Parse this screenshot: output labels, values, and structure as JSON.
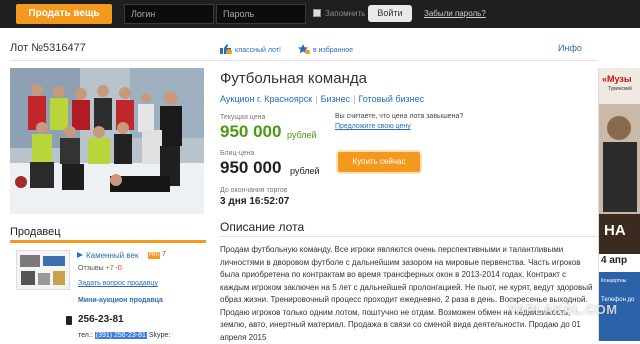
{
  "topbar": {
    "sell_button": "Продать вещь",
    "login_placeholder": "Логин",
    "password_placeholder": "Пароль",
    "remember_label": "Запомнить",
    "login_button": "Войти",
    "forgot_link": "Забыли пароль?"
  },
  "lot": {
    "number": "Лот №5316477",
    "classy_link": "классный лот!",
    "classy_count": "26",
    "favorite_link": "в избранное",
    "favorite_count": "19",
    "info_link": "Инфо",
    "title": "Футбольная команда",
    "breadcrumbs": [
      "Аукцион г. Красноярск",
      "Бизнес",
      "Готовый бизнес"
    ],
    "current_price_label": "Текущая цена",
    "current_price": "950 000",
    "currency": "рублей",
    "blitz_label": "Блиц-цена",
    "blitz_price": "950 000",
    "price_question": "Вы считаете, что цена лота завышена?",
    "suggest_price_link": "Предложите свою цену",
    "buy_now_button": "Купить сейчас",
    "time_left_label": "До окончания торгов",
    "time_left": "3 дня 16:52:07"
  },
  "seller": {
    "heading": "Продавец",
    "name": "Каменный век",
    "pro_badge": "PRO",
    "pro_number": "7",
    "reviews_label": "Отзывы",
    "reviews_positive": "+7",
    "reviews_negative": "-0",
    "ask_question_link": "Задать вопрос продавцу",
    "mini_auction_link": "Мини-аукцион продавца",
    "phone": "256-23-81",
    "tel_label": "тел.:",
    "tel_value": "(391) 256-23-81",
    "skype_label": "Skype:"
  },
  "description": {
    "heading": "Описание лота",
    "text": "Продам футбольную команду. Все игроки являются очень перспективными и талантливыми личностями в дворовом футболе с дальнейшим зазором на мировые первенства. Часть игроков была приобретена по контрактам во время трансферных окон в 2013-2014 годах. Контракт с каждым игроком заключен на 5 лет с дальнейшей пролонгацией. Не пьют, не курят, ведут здоровый образ жизни. Тренировочный процесс проходит ежедневно, 2 раза в день. Воскресенье выходной. Продаю игроков только одним лотом, поштучно не отдам. Возможен обмен на недвижимость, землю, авто, инертный материал. Продажа в связи со сменой вида деятельности. Продаю до 01 апреля 2015"
  },
  "ad": {
    "top_text": "«Музы",
    "sub_text": "Тувинский",
    "big_text": "НА",
    "date_text": "4 апр",
    "foot1": "Концертны",
    "foot2": "Телефон до"
  },
  "watermark": "YAPLAKAL.COM",
  "colors": {
    "accent_orange": "#f39a1e",
    "link_blue": "#2a6ebb",
    "price_green": "#4a9a10",
    "topbar_bg": "#1f1f1f"
  }
}
